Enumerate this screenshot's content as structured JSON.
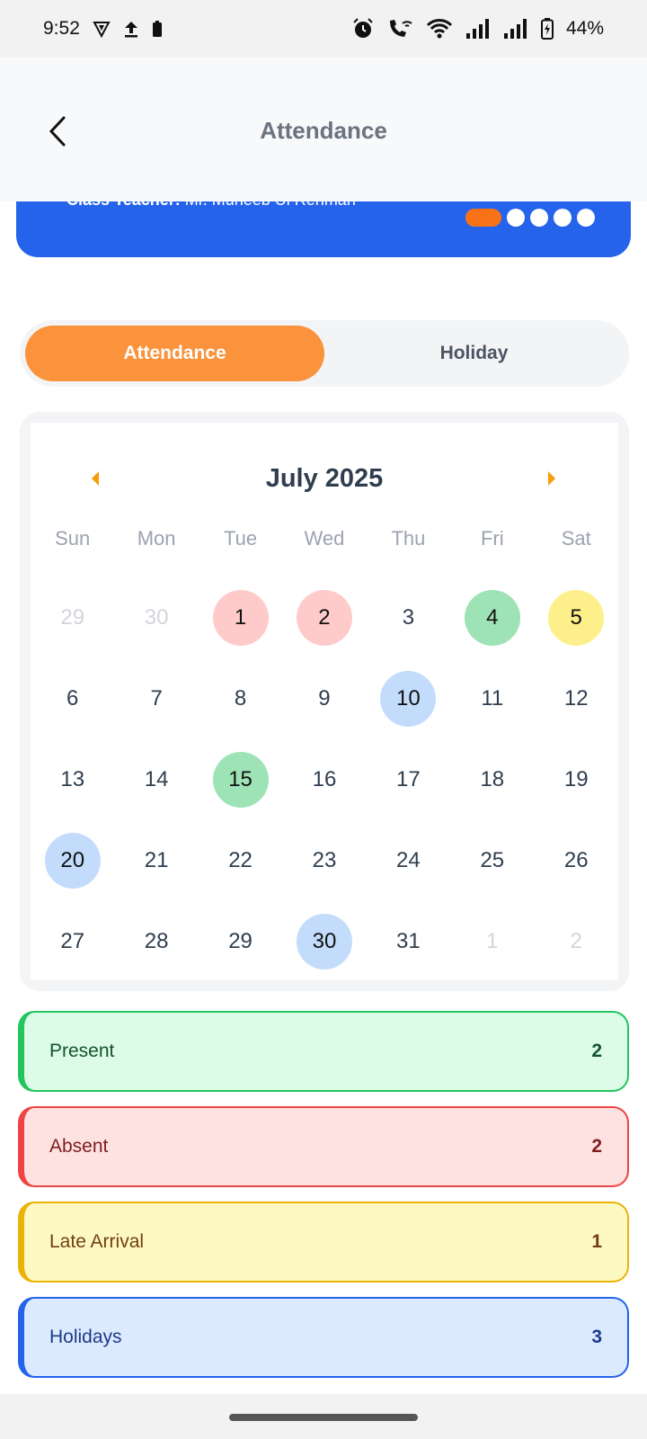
{
  "status_bar": {
    "time": "9:52",
    "battery": "44%",
    "icons_left": [
      "vpn-shield-icon",
      "upload-icon",
      "battery-small-icon"
    ],
    "icons_right": [
      "alarm-icon",
      "wifi-call-icon",
      "wifi-icon",
      "signal-icon",
      "signal-icon",
      "battery-charging-icon"
    ]
  },
  "header": {
    "title": "Attendance",
    "back_icon": "chevron-left-icon"
  },
  "banner": {
    "label": "Class Teacher:",
    "value": "Mr. Muneeb  Ul Rehman",
    "pager_total": 5,
    "pager_active": 1,
    "color": "#2563eb"
  },
  "tabs": [
    {
      "label": "Attendance",
      "active": true
    },
    {
      "label": "Holiday",
      "active": false
    }
  ],
  "calendar": {
    "month_title": "July 2025",
    "prev_icon": "caret-left-icon",
    "next_icon": "caret-right-icon",
    "weekdays": [
      "Sun",
      "Mon",
      "Tue",
      "Wed",
      "Thu",
      "Fri",
      "Sat"
    ],
    "weeks": [
      [
        {
          "d": "29",
          "s": "other"
        },
        {
          "d": "30",
          "s": "other"
        },
        {
          "d": "1",
          "s": "absent"
        },
        {
          "d": "2",
          "s": "absent"
        },
        {
          "d": "3",
          "s": ""
        },
        {
          "d": "4",
          "s": "present"
        },
        {
          "d": "5",
          "s": "late"
        }
      ],
      [
        {
          "d": "6",
          "s": ""
        },
        {
          "d": "7",
          "s": ""
        },
        {
          "d": "8",
          "s": ""
        },
        {
          "d": "9",
          "s": ""
        },
        {
          "d": "10",
          "s": "holiday"
        },
        {
          "d": "11",
          "s": ""
        },
        {
          "d": "12",
          "s": ""
        }
      ],
      [
        {
          "d": "13",
          "s": ""
        },
        {
          "d": "14",
          "s": ""
        },
        {
          "d": "15",
          "s": "present"
        },
        {
          "d": "16",
          "s": ""
        },
        {
          "d": "17",
          "s": ""
        },
        {
          "d": "18",
          "s": ""
        },
        {
          "d": "19",
          "s": ""
        }
      ],
      [
        {
          "d": "20",
          "s": "holiday"
        },
        {
          "d": "21",
          "s": ""
        },
        {
          "d": "22",
          "s": ""
        },
        {
          "d": "23",
          "s": ""
        },
        {
          "d": "24",
          "s": ""
        },
        {
          "d": "25",
          "s": ""
        },
        {
          "d": "26",
          "s": ""
        }
      ],
      [
        {
          "d": "27",
          "s": ""
        },
        {
          "d": "28",
          "s": ""
        },
        {
          "d": "29",
          "s": ""
        },
        {
          "d": "30",
          "s": "holiday"
        },
        {
          "d": "31",
          "s": ""
        },
        {
          "d": "1",
          "s": "other"
        },
        {
          "d": "2",
          "s": "other"
        }
      ]
    ]
  },
  "summary": {
    "present": {
      "label": "Present",
      "count": "2",
      "color": "#22c55e"
    },
    "absent": {
      "label": "Absent",
      "count": "2",
      "color": "#ef4444"
    },
    "late": {
      "label": "Late Arrival",
      "count": "1",
      "color": "#eab308"
    },
    "holidays": {
      "label": "Holidays",
      "count": "3",
      "color": "#2563eb"
    }
  }
}
